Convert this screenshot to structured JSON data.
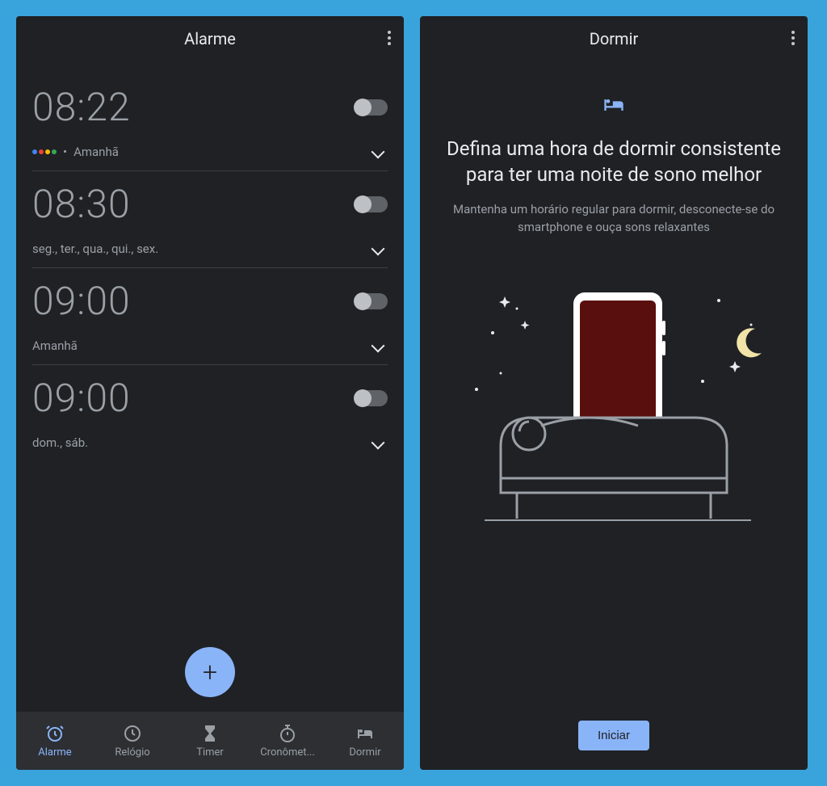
{
  "left": {
    "title": "Alarme",
    "alarms": [
      {
        "time": "08:22",
        "schedule": "Amanhã",
        "has_assistant": true
      },
      {
        "time": "08:30",
        "schedule": "seg., ter., qua., qui., sex.",
        "has_assistant": false
      },
      {
        "time": "09:00",
        "schedule": "Amanhã",
        "has_assistant": false
      },
      {
        "time": "09:00",
        "schedule": "dom., sáb.",
        "has_assistant": false
      }
    ],
    "fab": "+",
    "nav": [
      {
        "label": "Alarme",
        "icon": "alarm"
      },
      {
        "label": "Relógio",
        "icon": "clock"
      },
      {
        "label": "Timer",
        "icon": "hourglass"
      },
      {
        "label": "Cronômet...",
        "icon": "stopwatch"
      },
      {
        "label": "Dormir",
        "icon": "bed"
      }
    ]
  },
  "right": {
    "title": "Dormir",
    "heading": "Defina uma hora de dormir consistente para ter uma noite de sono melhor",
    "subtitle": "Mantenha um horário regular para dormir, desconecte-se do smartphone e ouça sons relaxantes",
    "start_button": "Iniciar"
  }
}
